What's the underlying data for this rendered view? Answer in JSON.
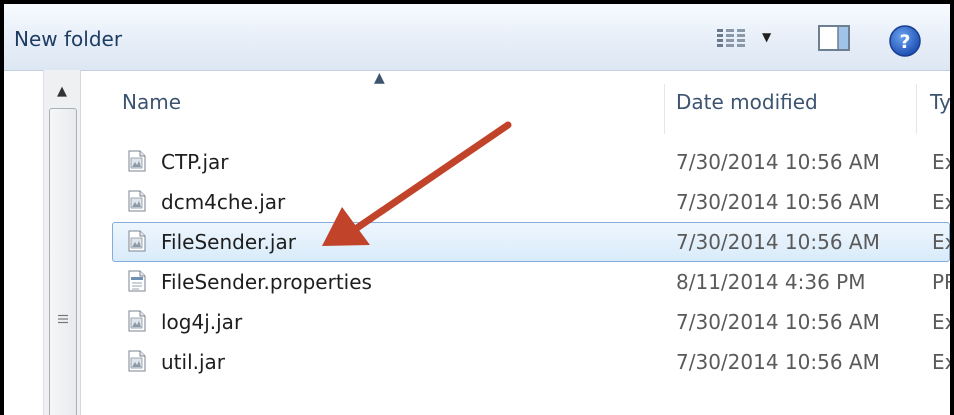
{
  "toolbar": {
    "new_folder_label": "New folder",
    "views_icon": "details-view-icon",
    "views_menu_icon": "chevron-down-icon",
    "preview_pane_icon": "preview-pane-icon",
    "help_icon": "help-icon"
  },
  "columns": {
    "name": "Name",
    "date_modified": "Date modified",
    "type": "Ty"
  },
  "files": [
    {
      "name": "CTP.jar",
      "date": "7/30/2014 10:56 AM",
      "type": "Ex",
      "icon": "jar-file-icon",
      "selected": false
    },
    {
      "name": "dcm4che.jar",
      "date": "7/30/2014 10:56 AM",
      "type": "Ex",
      "icon": "jar-file-icon",
      "selected": false
    },
    {
      "name": "FileSender.jar",
      "date": "7/30/2014 10:56 AM",
      "type": "Ex",
      "icon": "jar-file-icon",
      "selected": true
    },
    {
      "name": "FileSender.properties",
      "date": "8/11/2014 4:36 PM",
      "type": "PR",
      "icon": "properties-file-icon",
      "selected": false
    },
    {
      "name": "log4j.jar",
      "date": "7/30/2014 10:56 AM",
      "type": "Ex",
      "icon": "jar-file-icon",
      "selected": false
    },
    {
      "name": "util.jar",
      "date": "7/30/2014 10:56 AM",
      "type": "Ex",
      "icon": "jar-file-icon",
      "selected": false
    }
  ],
  "annotation": {
    "arrow_color": "#c0432a",
    "arrow_icon": "annotation-arrow"
  },
  "colors": {
    "selection_border": "#84acdd",
    "header_text": "#3d5470"
  }
}
